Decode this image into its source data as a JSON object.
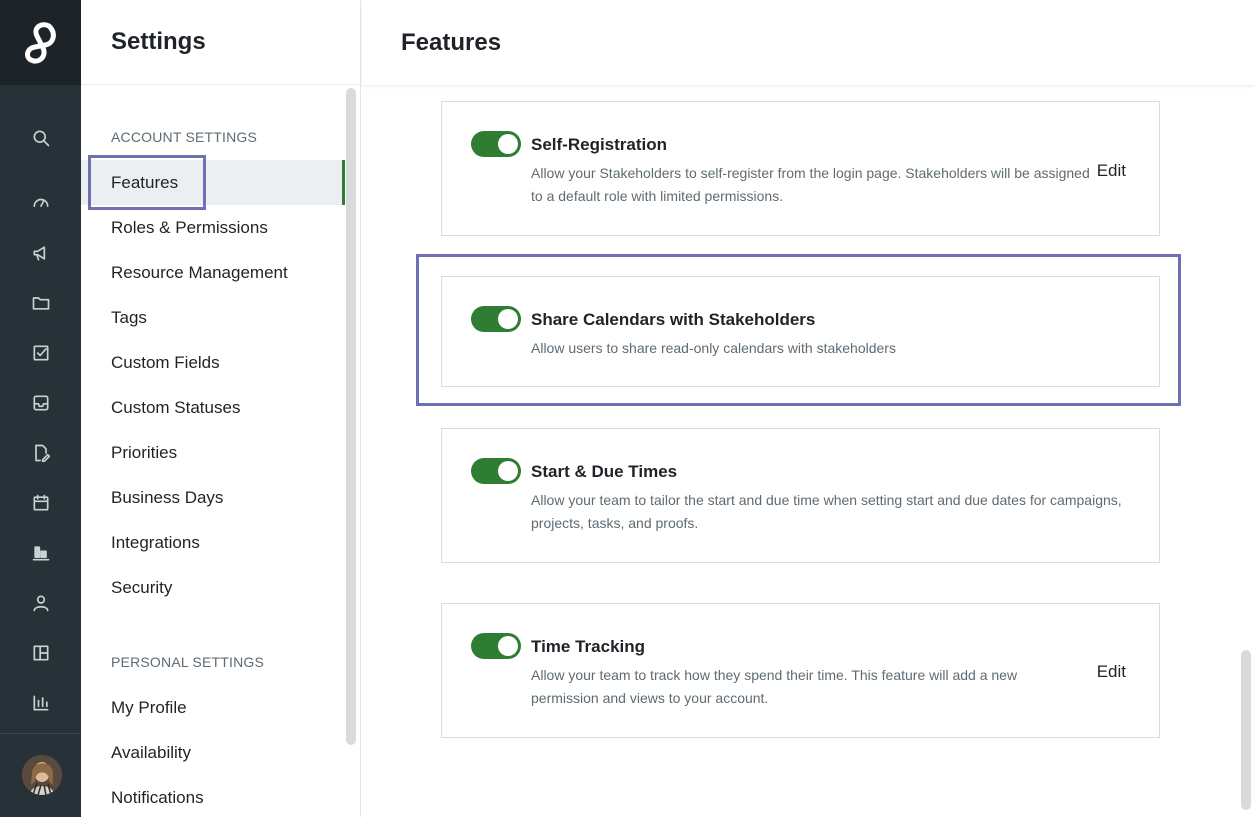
{
  "rail": {
    "logo": "logo-icon",
    "icons": [
      "search-icon",
      "dashboard-icon",
      "megaphone-icon",
      "folder-icon",
      "checkbox-icon",
      "inbox-icon",
      "document-edit-icon",
      "calendar-icon",
      "reports-bar-icon",
      "user-icon",
      "layout-icon",
      "chart-icon"
    ],
    "avatar": "avatar"
  },
  "sidebar": {
    "title": "Settings",
    "account_label": "ACCOUNT SETTINGS",
    "account_items": [
      {
        "label": "Features",
        "active": true
      },
      {
        "label": "Roles & Permissions"
      },
      {
        "label": "Resource Management"
      },
      {
        "label": "Tags"
      },
      {
        "label": "Custom Fields"
      },
      {
        "label": "Custom Statuses"
      },
      {
        "label": "Priorities"
      },
      {
        "label": "Business Days"
      },
      {
        "label": "Integrations"
      },
      {
        "label": "Security"
      }
    ],
    "personal_label": "PERSONAL SETTINGS",
    "personal_items": [
      {
        "label": "My Profile"
      },
      {
        "label": "Availability"
      },
      {
        "label": "Notifications"
      }
    ]
  },
  "main": {
    "title": "Features",
    "cards": [
      {
        "title": "Self-Registration",
        "description": "Allow your Stakeholders to self-register from the login page. Stakeholders will be assigned to a default role with limited permissions.",
        "enabled": true,
        "edit_label": "Edit"
      },
      {
        "title": "Share Calendars with Stakeholders",
        "description": "Allow users to share read-only calendars with stakeholders",
        "enabled": true,
        "edit_label": ""
      },
      {
        "title": "Start & Due Times",
        "description": "Allow your team to tailor the start and due time when setting start and due dates for campaigns, projects, tasks, and proofs.",
        "enabled": true,
        "edit_label": ""
      },
      {
        "title": "Time Tracking",
        "description": "Allow your team to track how they spend their time. This feature will add a new permission and views to your account.",
        "enabled": true,
        "edit_label": "Edit"
      }
    ]
  },
  "colors": {
    "rail_bg": "#263238",
    "toggle_on": "#2e7d32",
    "highlight": "#6f6fb3"
  }
}
